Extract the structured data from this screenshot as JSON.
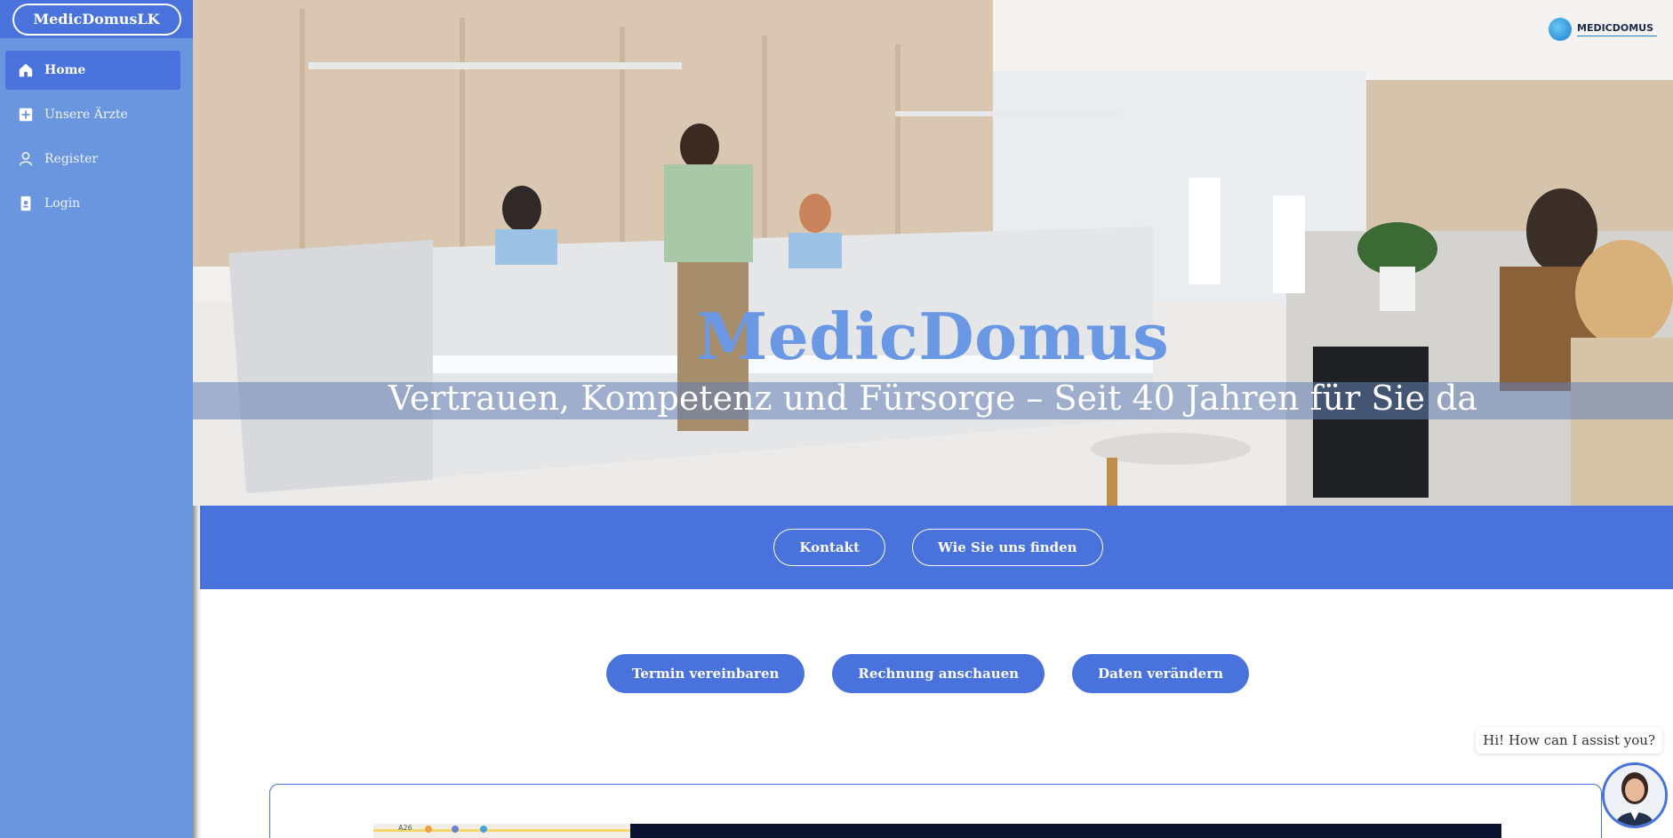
{
  "sidebar": {
    "brand": "MedicDomusLK",
    "items": [
      {
        "label": "Home",
        "icon": "home-icon",
        "active": true
      },
      {
        "label": "Unsere Ärzte",
        "icon": "plus-square-icon",
        "active": false
      },
      {
        "label": "Register",
        "icon": "user-icon",
        "active": false
      },
      {
        "label": "Login",
        "icon": "badge-icon",
        "active": false
      }
    ]
  },
  "hero": {
    "title": "MedicDomus",
    "subtitle": "Vertrauen, Kompetenz und Fürsorge – Seit 40 Jahren für Sie da",
    "logo_text": "MEDICDOMUS"
  },
  "band": {
    "buttons": [
      "Kontakt",
      "Wie Sie uns finden"
    ]
  },
  "actions": {
    "buttons": [
      "Termin vereinbaren",
      "Rechnung anschauen",
      "Daten verändern"
    ]
  },
  "map": {
    "road_label": "A26"
  },
  "chat": {
    "greeting": "Hi! How can I assist you?"
  },
  "colors": {
    "primary": "#4a72dc",
    "sidebar": "#6a96e0",
    "title_blue": "#6b98e4"
  }
}
